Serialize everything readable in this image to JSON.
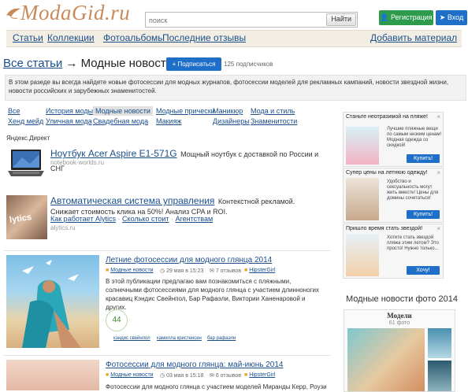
{
  "header": {
    "logo_text": "ModaGid.ru",
    "search_placeholder": "поиск",
    "search_button": "Найти",
    "register_button": "Регистрация",
    "login_button": "Вход"
  },
  "nav": {
    "items": [
      "Статьи",
      "Коллекции",
      "Фотоальбомы",
      "Последние отзывы"
    ],
    "add_material": "Добавить материал"
  },
  "title": {
    "link": "Все статьи",
    "rest": " → Модные новости",
    "subscribe_button": "Подписаться",
    "subscribers": "125 подписчиков"
  },
  "intro": "В этом разеде вы всегда найдете новые фотосессии для модных журнапов, фотосессии моделей для рекламных кампаний, новости звездной жизни, новости российских и зарубежных знаменитостей.",
  "categories": {
    "row1": [
      "Все",
      "История моды",
      "Модные новости",
      "Модные прически",
      "Маникюр",
      "Мода и стиль"
    ],
    "row2": [
      "Хенд мейд",
      "Уличная мода",
      "Свадебная мода",
      "Макияж",
      "Дизайнеры",
      "Знаменитости"
    ],
    "active": "Модные новости"
  },
  "direct": {
    "label": "Яндекс.Директ",
    "ads": [
      {
        "title": "Ноутбук Acer Aspire E1-571G",
        "text": "Мощный ноутбук с доставкой по России и СНГ",
        "domain": "notebook-worlds.ru"
      },
      {
        "title": "Автоматическая система управления",
        "text": "Контекстной рекламой. Снижает стоимость клика на 50%! Анализ CPA и ROI.",
        "links": [
          "Как работает Alytics",
          "Сколько стоит",
          "Агентствам"
        ],
        "domain": "alytics.ru",
        "image_text": "lytics"
      }
    ]
  },
  "articles": [
    {
      "title": "Летние фотосессии для модного глянца 2014",
      "category": "Модные новости",
      "date": "29 мая в 15:23",
      "reviews": "7 отзывов",
      "author": "HipsterGirl",
      "text": "В этой публикации предлагаю вам познакомиться с пляжными, солнечными фотосессиями для модного глянца с участием длинноногих красавиц Кэндис Свейнпол, Бар Рафаэли, Виктории Ханенаровой и других.",
      "likes": "44",
      "tags": [
        "кэндис свейнпол",
        "камилла кристенсен",
        "бар рафаэли"
      ]
    },
    {
      "title": "Фотосессии для модного глянца: май-июнь 2014",
      "category": "Модные новости",
      "date": "03 мая в 15:18",
      "reviews": "6 отзывов",
      "author": "HipsterGirl",
      "text": "Фотосессии для модного глянца с участием моделей Миранды Керр, Роузи"
    }
  ],
  "sidebar_ads": [
    {
      "head": "Станьте неотразимой на пляже!",
      "text": "Лучшие пляжные вещи по самым низким ценам! Модная одежда со скидкой!",
      "button": "Купить!"
    },
    {
      "head": "Супер цены на летнюю одежду!",
      "text": "Удобство и сексуальность могут жить вместе! Цены для домины сочетаться!",
      "button": "Купить!"
    },
    {
      "head": "Пришло время стать звездой!",
      "text": "Хотите стать звездой пляжа этим летом? Это просто! Нужно только...",
      "button": "Хочу!"
    }
  ],
  "gallery": {
    "title": "Модные новости фото 2014",
    "album_title": "Модели",
    "album_count": "61 фото"
  },
  "colors": {
    "link": "#1a4f8c",
    "register_green": "#2d9a4c",
    "login_blue": "#1f6fc8",
    "nav_bg": "#f3eee4",
    "logo": "#c98a5a"
  }
}
